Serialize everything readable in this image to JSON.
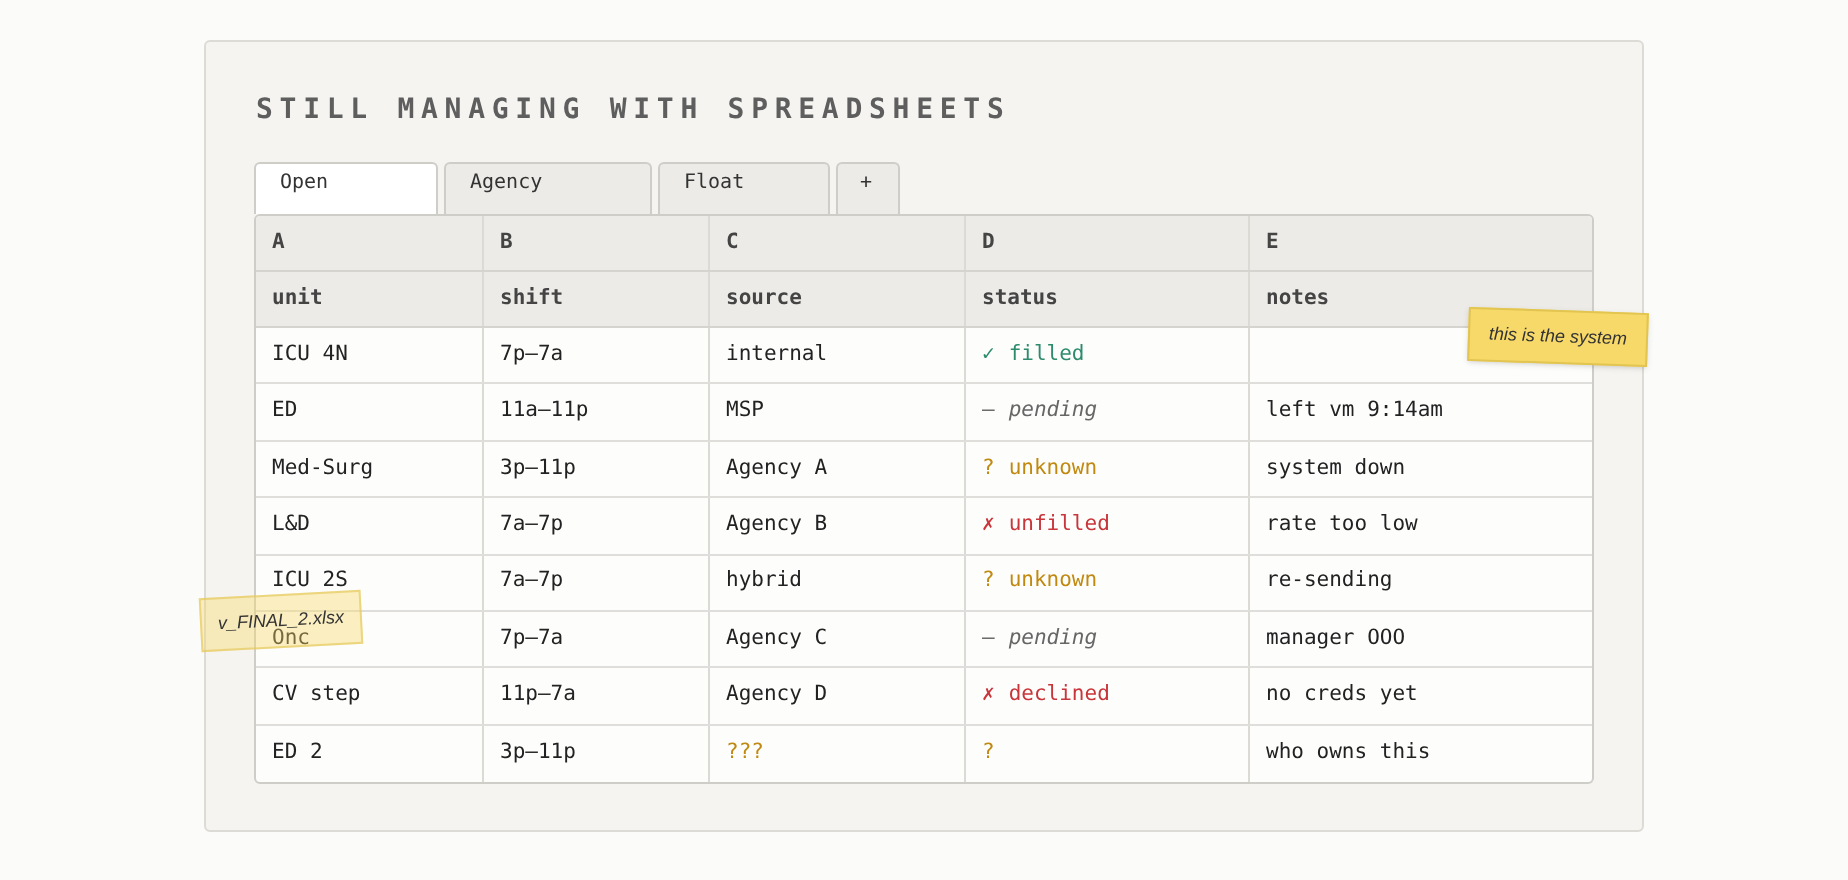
{
  "title": "STILL MANAGING WITH SPREADSHEETS",
  "tabs": [
    {
      "label": "Open",
      "selected": true
    },
    {
      "label": "Agency",
      "selected": false
    },
    {
      "label": "Float",
      "selected": false
    },
    {
      "label": "+",
      "selected": false
    }
  ],
  "table": {
    "column_letters": [
      "A",
      "B",
      "C",
      "D",
      "E"
    ],
    "columns": [
      "unit",
      "shift",
      "source",
      "status",
      "notes"
    ],
    "rows": [
      {
        "unit": "ICU 4N",
        "shift": "7p–7a",
        "source": "internal",
        "source_flagged": false,
        "status": {
          "kind": "filled",
          "mark": "✓",
          "text": "filled"
        }
      },
      {
        "unit": "ED",
        "shift": "11a–11p",
        "source": "MSP",
        "source_flagged": false,
        "status": {
          "kind": "pending",
          "mark": "—",
          "text": "pending"
        },
        "notes": "left vm 9:14am"
      },
      {
        "unit": "Med-Surg",
        "shift": "3p–11p",
        "source": "Agency A",
        "source_flagged": false,
        "status": {
          "kind": "unknown",
          "mark": "?",
          "text": "unknown"
        },
        "notes": "system down"
      },
      {
        "unit": "L&D",
        "shift": "7a–7p",
        "source": "Agency B",
        "source_flagged": false,
        "status": {
          "kind": "failed",
          "mark": "✗",
          "text": "unfilled"
        },
        "notes": "rate too low"
      },
      {
        "unit": "ICU 2S",
        "shift": "7a–7p",
        "source": "hybrid",
        "source_flagged": false,
        "status": {
          "kind": "unknown",
          "mark": "?",
          "text": "unknown"
        },
        "notes": "re-sending"
      },
      {
        "unit": "Onc",
        "shift": "7p–7a",
        "source": "Agency C",
        "source_flagged": false,
        "status": {
          "kind": "pending",
          "mark": "—",
          "text": "pending"
        },
        "notes": "manager OOO"
      },
      {
        "unit": "CV step",
        "shift": "11p–7a",
        "source": "Agency D",
        "source_flagged": false,
        "status": {
          "kind": "failed",
          "mark": "✗",
          "text": "declined"
        },
        "notes": "no creds yet"
      },
      {
        "unit": "ED 2",
        "shift": "3p–11p",
        "source": "???",
        "source_flagged": true,
        "status": {
          "kind": "unknown",
          "mark": "?"
        },
        "notes": "who owns this"
      }
    ]
  },
  "sticky_notes": [
    {
      "text": "this is the system"
    },
    {
      "text": "v_FINAL_2.xlsx"
    }
  ]
}
